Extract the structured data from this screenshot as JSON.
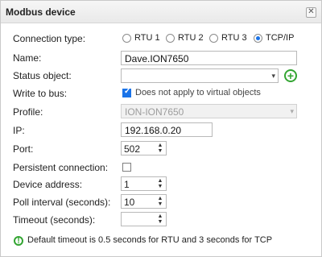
{
  "dialog": {
    "title": "Modbus device",
    "close_symbol": "✕"
  },
  "connection_type": {
    "label": "Connection type:",
    "options": [
      "RTU 1",
      "RTU 2",
      "RTU 3",
      "TCP/IP"
    ],
    "selected": "TCP/IP"
  },
  "name": {
    "label": "Name:",
    "value": "Dave.ION7650"
  },
  "status_object": {
    "label": "Status object:",
    "value": ""
  },
  "write_to_bus": {
    "label": "Write to bus:",
    "checked": true,
    "note": "Does not apply to virtual objects"
  },
  "profile": {
    "label": "Profile:",
    "value": "ION-ION7650",
    "disabled": true
  },
  "ip": {
    "label": "IP:",
    "value": "192.168.0.20"
  },
  "port": {
    "label": "Port:",
    "value": "502"
  },
  "persistent_connection": {
    "label": "Persistent connection:",
    "checked": false
  },
  "device_address": {
    "label": "Device address:",
    "value": "1"
  },
  "poll_interval": {
    "label": "Poll interval (seconds):",
    "value": "10"
  },
  "timeout": {
    "label": "Timeout (seconds):",
    "value": ""
  },
  "info": {
    "text": "Default timeout is 0.5 seconds for RTU and 3 seconds for TCP"
  },
  "icons": {
    "add": "add-icon",
    "info": "info-icon",
    "close": "close-icon"
  },
  "colors": {
    "accent": "#1a73e8",
    "success": "#33a532"
  }
}
